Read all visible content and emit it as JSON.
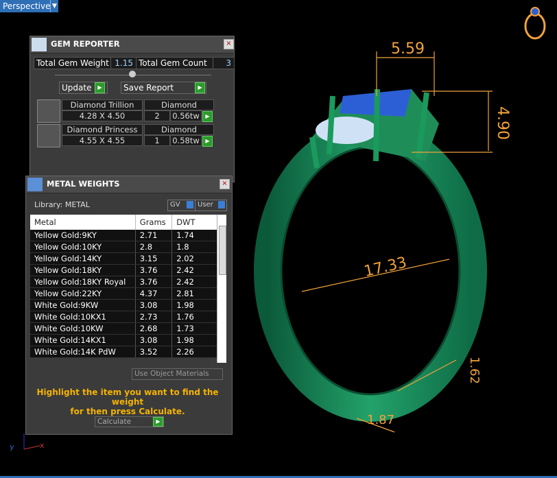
{
  "viewport": {
    "mode_label": "Perspective",
    "dimensions": [
      "5.59",
      "4.90",
      "17.33",
      "1.62",
      "1.87"
    ],
    "axis_labels": {
      "y": "y",
      "x": "x"
    }
  },
  "gem_reporter": {
    "title": "GEM REPORTER",
    "total_weight_label": "Total Gem Weight",
    "total_weight_value": "1.15",
    "total_count_label": "Total Gem Count",
    "total_count_value": "3",
    "update_label": "Update",
    "save_label": "Save Report",
    "rows": [
      {
        "name": "Diamond Trillion",
        "size": "4.28 X 4.50",
        "material": "Diamond",
        "count": "2",
        "weight": "0.56tw"
      },
      {
        "name": "Diamond Princess",
        "size": "4.55 X 4.55",
        "material": "Diamond",
        "count": "1",
        "weight": "0.58tw"
      }
    ]
  },
  "metal_weights": {
    "title": "METAL WEIGHTS",
    "library_label": "Library: METAL",
    "gv_label": "GV",
    "user_label": "User",
    "columns": [
      "Metal",
      "Grams",
      "DWT"
    ],
    "rows": [
      [
        "Yellow Gold:9KY",
        "2.71",
        "1.74"
      ],
      [
        "Yellow Gold:10KY",
        "2.8",
        "1.8"
      ],
      [
        "Yellow Gold:14KY",
        "3.15",
        "2.02"
      ],
      [
        "Yellow Gold:18KY",
        "3.76",
        "2.42"
      ],
      [
        "Yellow Gold:18KY Royal",
        "3.76",
        "2.42"
      ],
      [
        "Yellow Gold:22KY",
        "4.37",
        "2.81"
      ],
      [
        "White Gold:9KW",
        "3.08",
        "1.98"
      ],
      [
        "White Gold:10KX1",
        "2.73",
        "1.76"
      ],
      [
        "White Gold:10KW",
        "2.68",
        "1.73"
      ],
      [
        "White Gold:14KX1",
        "3.08",
        "1.98"
      ],
      [
        "White Gold:14K PdW",
        "3.52",
        "2.26"
      ]
    ],
    "use_object_label": "Use Object Materials",
    "hint_line1": "Highlight the item you want to find the weight",
    "hint_line2": "for then press Calculate.",
    "calculate_label": "Calculate"
  }
}
